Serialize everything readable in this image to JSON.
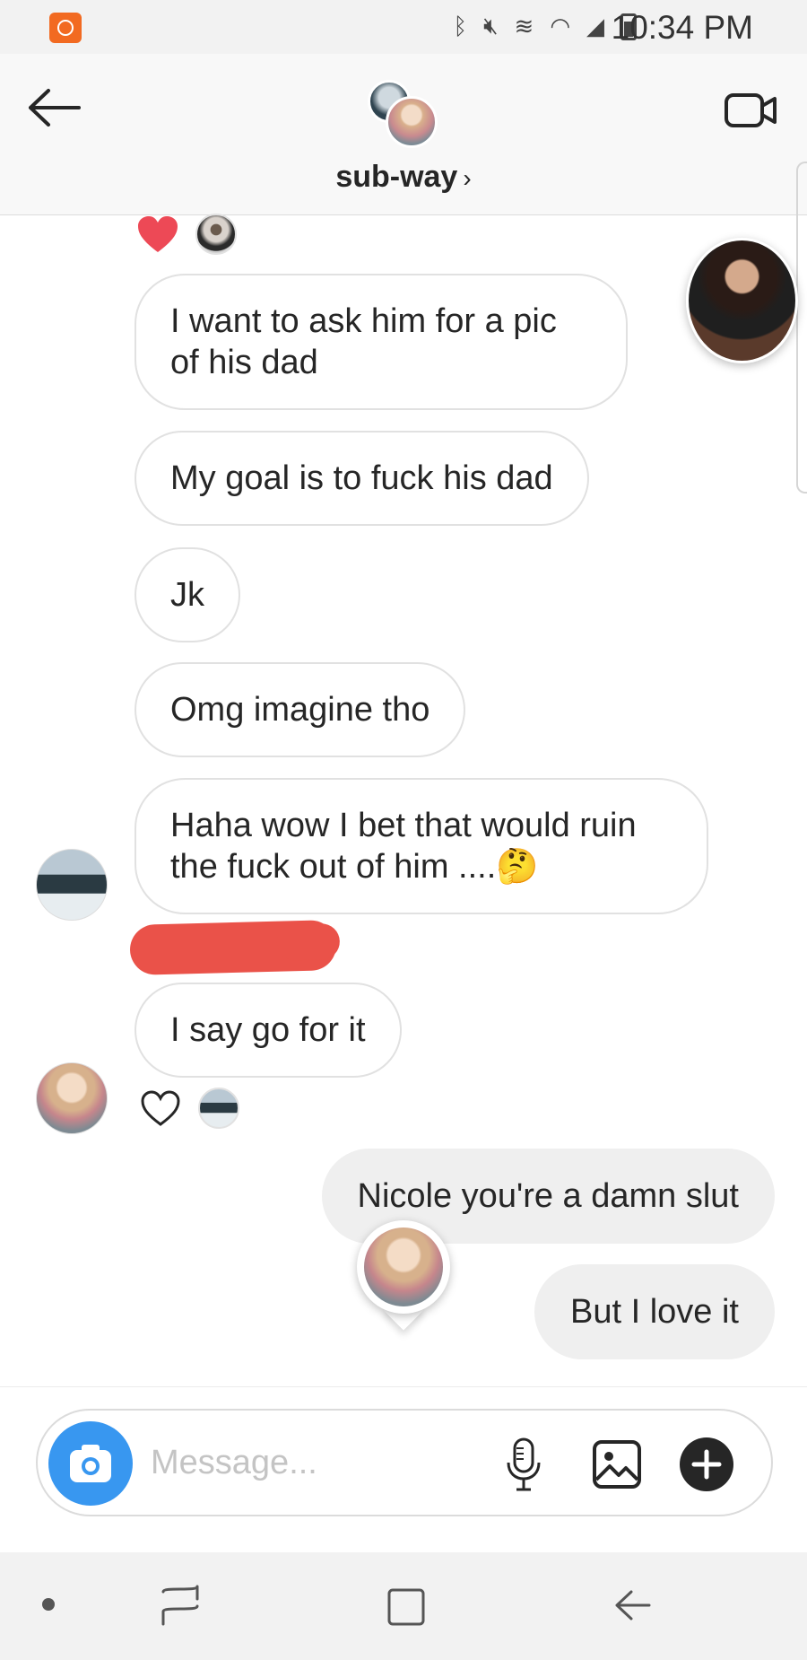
{
  "status_bar": {
    "time": "10:34 PM",
    "icons": [
      "bluetooth-icon",
      "mute-icon",
      "vibrate-icon",
      "wifi-icon",
      "signal-icon",
      "battery-icon"
    ]
  },
  "header": {
    "title": "sub-way",
    "chevron": "›"
  },
  "messages": [
    {
      "text": "I want to ask him for a pic of his dad"
    },
    {
      "text": "My goal is to fuck his dad"
    },
    {
      "text": "Jk"
    },
    {
      "text": "Omg imagine tho"
    },
    {
      "text": "Haha wow I bet that would ruin the fuck out of him ....🤔"
    },
    {
      "text": "I say go for it"
    },
    {
      "text": "Nicole you're a damn slut"
    },
    {
      "text": "But I love it"
    }
  ],
  "composer": {
    "placeholder": "Message..."
  },
  "colors": {
    "accent_blue": "#3897f0",
    "heart_red": "#ed4956",
    "redaction": "#ea5249",
    "bubble_border": "#e1e1e1",
    "own_bubble": "#efefef"
  }
}
